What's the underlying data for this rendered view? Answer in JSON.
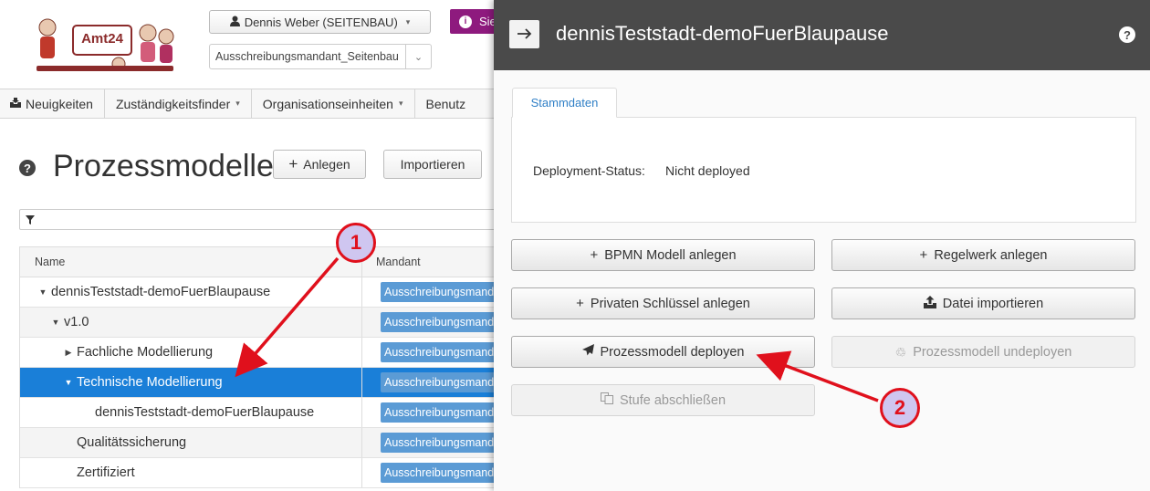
{
  "header": {
    "logo_text": "Amt24",
    "user_button": "Dennis Weber (SEITENBAU)",
    "mandant_select": "Ausschreibungsmandant_Seitenbau",
    "purple_button": "Sie"
  },
  "nav": {
    "items": [
      "Neuigkeiten",
      "Zuständigkeitsfinder",
      "Organisationseinheiten",
      "Benutz"
    ]
  },
  "page": {
    "title": "Prozessmodelle",
    "anlegen_label": "Anlegen",
    "importieren_label": "Importieren"
  },
  "grid": {
    "columns": [
      "Name",
      "Mandant"
    ],
    "rows": [
      {
        "name": "dennisTeststadt-demoFuerBlaupause",
        "mandant": "Ausschreibungsmandant_Seitenbau",
        "level": 0,
        "caret": "down",
        "selected": false
      },
      {
        "name": "v1.0",
        "mandant": "Ausschreibungsmandant_Seitenbau",
        "level": 1,
        "caret": "down",
        "selected": false
      },
      {
        "name": "Fachliche Modellierung",
        "mandant": "Ausschreibungsmandant_Seitenbau",
        "level": 2,
        "caret": "right",
        "selected": false
      },
      {
        "name": "Technische Modellierung",
        "mandant": "Ausschreibungsmandant_Seitenbau",
        "level": 2,
        "caret": "down",
        "selected": true
      },
      {
        "name": "dennisTeststadt-demoFuerBlaupause",
        "mandant": "Ausschreibungsmandant_Seitenbau",
        "level": 3,
        "caret": "",
        "selected": false
      },
      {
        "name": "Qualitätssicherung",
        "mandant": "Ausschreibungsmandant_Seitenbau",
        "level": 2,
        "caret": "",
        "selected": false
      },
      {
        "name": "Zertifiziert",
        "mandant": "Ausschreibungsmandant_Seitenbau",
        "level": 2,
        "caret": "",
        "selected": false
      }
    ]
  },
  "panel": {
    "title": "dennisTeststadt-demoFuerBlaupause",
    "tab": "Stammdaten",
    "status_label": "Deployment-Status:",
    "status_value": "Nicht deployed",
    "buttons": {
      "bpmn": "BPMN Modell anlegen",
      "regelwerk": "Regelwerk anlegen",
      "privat": "Privaten Schlüssel anlegen",
      "datei": "Datei importieren",
      "deploy": "Prozessmodell deployen",
      "undeploy": "Prozessmodell undeployen",
      "stufe": "Stufe abschließen"
    }
  },
  "annotations": {
    "marker1": "1",
    "marker2": "2",
    "color": "#e0101c"
  }
}
